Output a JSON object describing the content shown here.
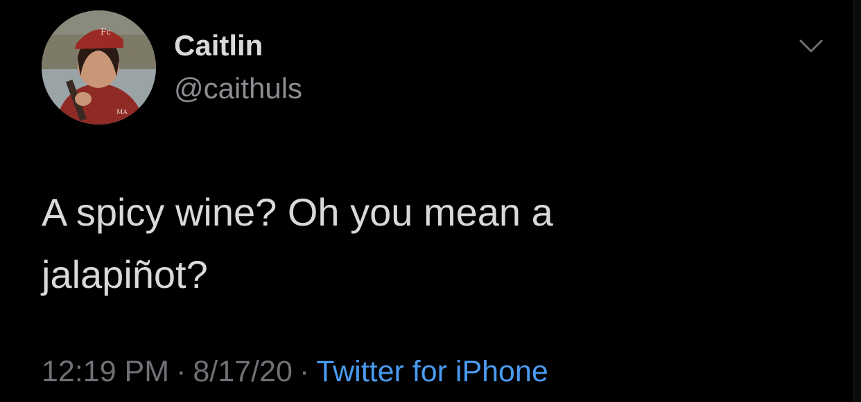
{
  "user": {
    "display_name": "Caitlin",
    "handle": "@caithuls"
  },
  "tweet": {
    "text_line1": "A spicy wine? Oh you mean a",
    "text_line2": "jalapiñot?",
    "time": "12:19 PM",
    "date": "8/17/20",
    "separator": "·",
    "source": "Twitter for iPhone"
  },
  "icons": {
    "avatar": "profile-photo",
    "menu": "chevron-down-icon"
  },
  "colors": {
    "background": "#000000",
    "primary_text": "#d9d9d9",
    "secondary_text": "#8a8d91",
    "link": "#4a9bf0"
  }
}
